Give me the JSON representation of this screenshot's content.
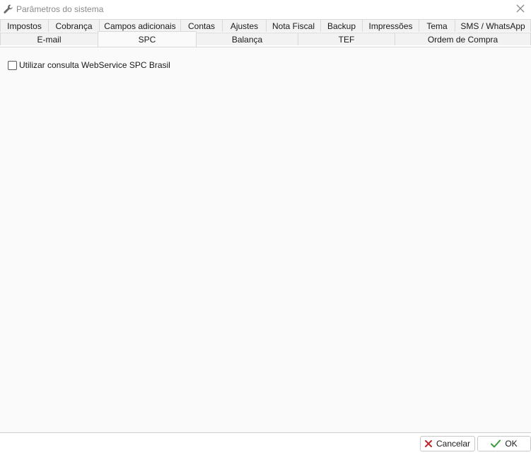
{
  "window": {
    "title": "Parâmetros do sistema",
    "icon": "wrench-icon"
  },
  "tabs": {
    "row1": [
      {
        "label": "Impostos"
      },
      {
        "label": "Cobrança"
      },
      {
        "label": "Campos adicionais"
      },
      {
        "label": "Contas"
      },
      {
        "label": "Ajustes"
      },
      {
        "label": "Nota Fiscal"
      },
      {
        "label": "Backup"
      },
      {
        "label": "Impressões"
      },
      {
        "label": "Tema"
      },
      {
        "label": "SMS / WhatsApp"
      }
    ],
    "row2": [
      {
        "label": "E-mail"
      },
      {
        "label": "SPC",
        "active": true
      },
      {
        "label": "Balança"
      },
      {
        "label": "TEF"
      },
      {
        "label": "Ordem de Compra"
      }
    ]
  },
  "spc": {
    "use_webservice_label": "Utilizar consulta WebService SPC Brasil",
    "use_webservice_checked": false
  },
  "footer": {
    "cancel_label": "Cancelar",
    "ok_label": "OK"
  },
  "colors": {
    "cancel_icon": "#c0282d",
    "ok_icon": "#3a9b3a"
  }
}
